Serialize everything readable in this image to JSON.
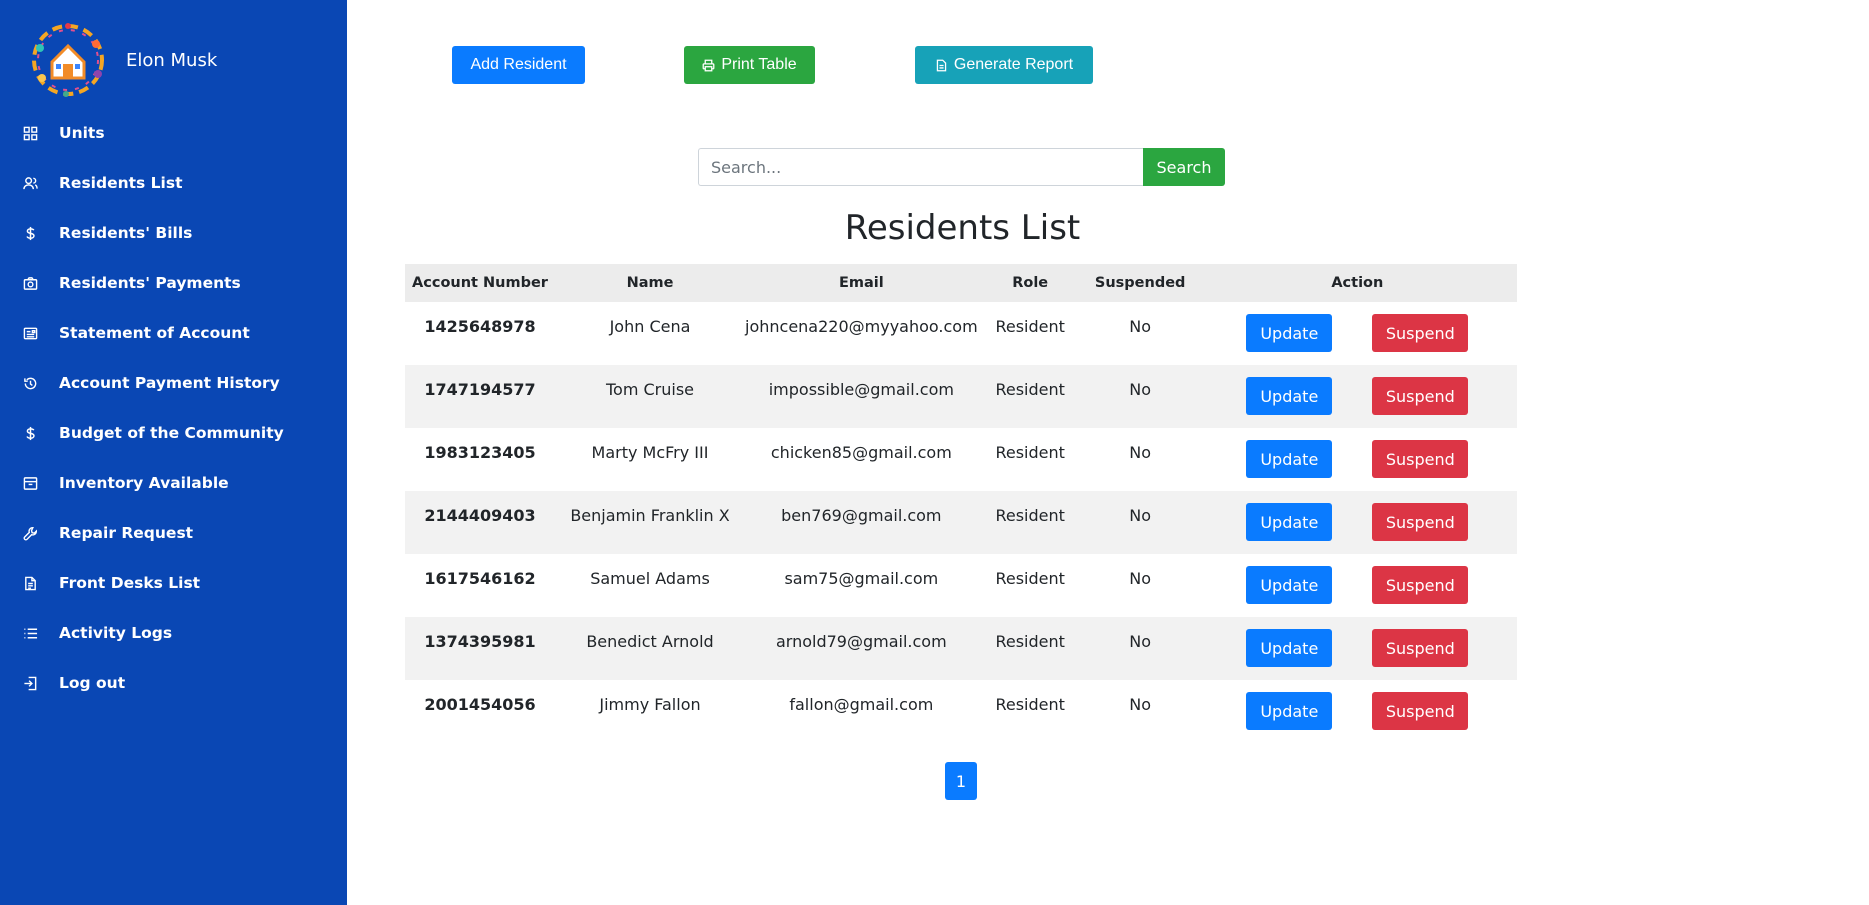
{
  "user": {
    "name": "Elon Musk"
  },
  "sidebar": {
    "items": [
      {
        "label": "Units",
        "icon": "grid-icon"
      },
      {
        "label": "Residents List",
        "icon": "users-icon"
      },
      {
        "label": "Residents' Bills",
        "icon": "dollar-icon"
      },
      {
        "label": "Residents' Payments",
        "icon": "camera-icon"
      },
      {
        "label": "Statement of Account",
        "icon": "id-card-icon"
      },
      {
        "label": "Account Payment History",
        "icon": "history-icon"
      },
      {
        "label": "Budget of the Community",
        "icon": "dollar-icon"
      },
      {
        "label": "Inventory Available",
        "icon": "archive-icon"
      },
      {
        "label": "Repair Request",
        "icon": "wrench-icon"
      },
      {
        "label": "Front Desks List",
        "icon": "document-icon"
      },
      {
        "label": "Activity Logs",
        "icon": "list-icon"
      },
      {
        "label": "Log out",
        "icon": "logout-icon"
      }
    ]
  },
  "toolbar": {
    "add_label": "Add Resident",
    "print_label": "Print Table",
    "report_label": "Generate Report"
  },
  "search": {
    "placeholder": "Search...",
    "button_label": "Search"
  },
  "page_title": "Residents List",
  "table": {
    "headers": [
      "Account Number",
      "Name",
      "Email",
      "Role",
      "Suspended",
      "Action"
    ],
    "rows": [
      {
        "account": "1425648978",
        "name": "John Cena",
        "email": "johncena220@myyahoo.com",
        "role": "Resident",
        "suspended": "No"
      },
      {
        "account": "1747194577",
        "name": "Tom Cruise",
        "email": "impossible@gmail.com",
        "role": "Resident",
        "suspended": "No"
      },
      {
        "account": "1983123405",
        "name": "Marty McFry III",
        "email": "chicken85@gmail.com",
        "role": "Resident",
        "suspended": "No"
      },
      {
        "account": "2144409403",
        "name": "Benjamin Franklin X",
        "email": "ben769@gmail.com",
        "role": "Resident",
        "suspended": "No"
      },
      {
        "account": "1617546162",
        "name": "Samuel Adams",
        "email": "sam75@gmail.com",
        "role": "Resident",
        "suspended": "No"
      },
      {
        "account": "1374395981",
        "name": "Benedict Arnold",
        "email": "arnold79@gmail.com",
        "role": "Resident",
        "suspended": "No"
      },
      {
        "account": "2001454056",
        "name": "Jimmy Fallon",
        "email": "fallon@gmail.com",
        "role": "Resident",
        "suspended": "No"
      }
    ],
    "update_label": "Update",
    "suspend_label": "Suspend"
  },
  "pagination": {
    "current": "1"
  },
  "colors": {
    "sidebar": "#0a47b4",
    "primary": "#0a7bff",
    "success": "#2ba640",
    "info": "#17a2b8",
    "danger": "#dc3545"
  }
}
